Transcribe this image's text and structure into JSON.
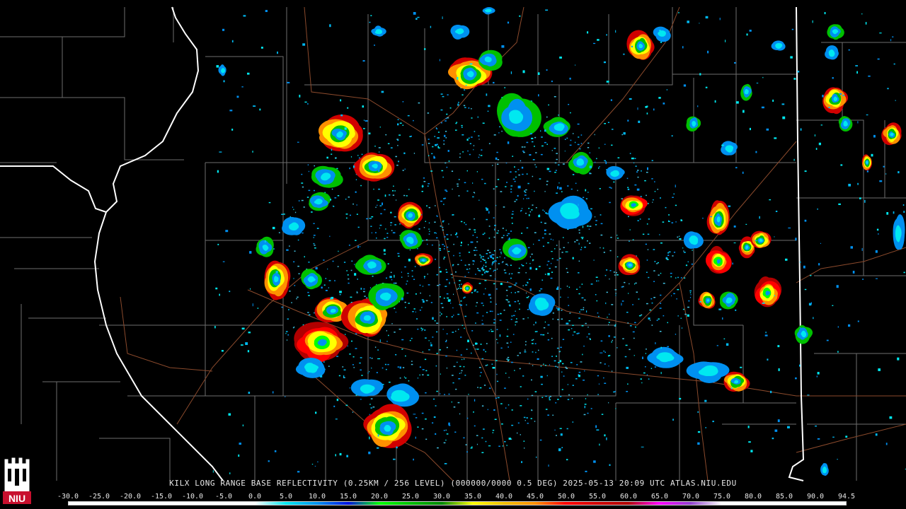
{
  "header": {
    "caption": "KILX LONG RANGE BASE REFLECTIVITY (0.25KM / 256 LEVEL) (000000/0000 0.5 DEG) 2025-05-13 20:09 UTC  ATLAS.NIU.EDU"
  },
  "logo": {
    "text": "NIU",
    "icon": "niu-castle-icon"
  },
  "legend": {
    "labels": [
      "-30.0",
      "-25.0",
      "-20.0",
      "-15.0",
      "-10.0",
      "-5.0",
      "0.0",
      "5.0",
      "10.0",
      "15.0",
      "20.0",
      "25.0",
      "30.0",
      "35.0",
      "40.0",
      "45.0",
      "50.0",
      "55.0",
      "60.0",
      "65.0",
      "70.0",
      "75.0",
      "80.0",
      "85.0",
      "90.0",
      "94.5"
    ],
    "colors": [
      "#ffffff",
      "#ffffff",
      "#ffffff",
      "#ffffff",
      "#ffffff",
      "#ffffff",
      "#ffffff",
      "#00e8f0",
      "#0090f0",
      "#0010e0",
      "#00ff00",
      "#00c000",
      "#008800",
      "#ffff00",
      "#f0c000",
      "#ff9000",
      "#ff0000",
      "#d00000",
      "#b00000",
      "#ff00ff",
      "#9040d0",
      "#ffffff",
      "#ffffff",
      "#ffffff",
      "#ffffff",
      "#ffffff"
    ]
  },
  "colors": {
    "background": "#000000",
    "county_lines": "#6e6e6e",
    "state_lines": "#ffffff",
    "roads": "#8b4a2c"
  }
}
